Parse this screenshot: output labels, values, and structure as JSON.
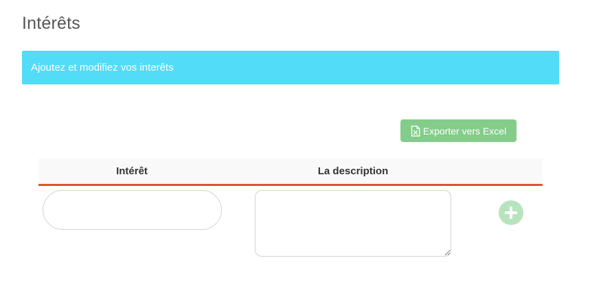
{
  "page": {
    "title": "Intérêts"
  },
  "banner": {
    "text": "Ajoutez et modifiez vos interêts",
    "color": "#52dcf7"
  },
  "toolbar": {
    "export_label": "Exporter vers Excel",
    "export_icon": "excel-file-icon",
    "export_color": "#84cc8a"
  },
  "table": {
    "columns": [
      "Intérêt",
      "La description"
    ],
    "header_accent_color": "#e0512e",
    "new_row": {
      "interet_value": "",
      "description_value": "",
      "add_icon": "plus-circle-icon"
    }
  }
}
